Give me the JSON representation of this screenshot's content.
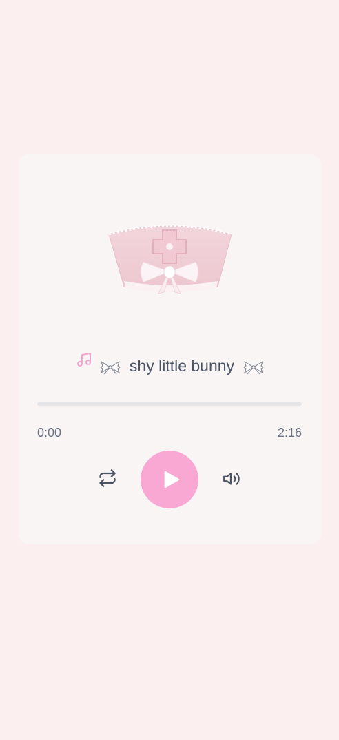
{
  "player": {
    "track_title": "shy little bunny",
    "cover_art": "pink nurse cap with bow",
    "current_time": "0:00",
    "total_time": "2:16",
    "progress_fraction": 0
  },
  "icons": {
    "note": "music-note-icon",
    "title_left": "ribbon-bow-icon",
    "title_right": "ribbon-bow-icon",
    "repeat": "repeat-icon",
    "play": "play-icon",
    "volume": "volume-icon"
  },
  "colors": {
    "page_background": "#fbeff0",
    "card_background": "#faf5f5",
    "accent": "#f9a8d4",
    "title_text": "#4b5563",
    "time_text": "#6b7280",
    "track": "#e5e5e7"
  }
}
